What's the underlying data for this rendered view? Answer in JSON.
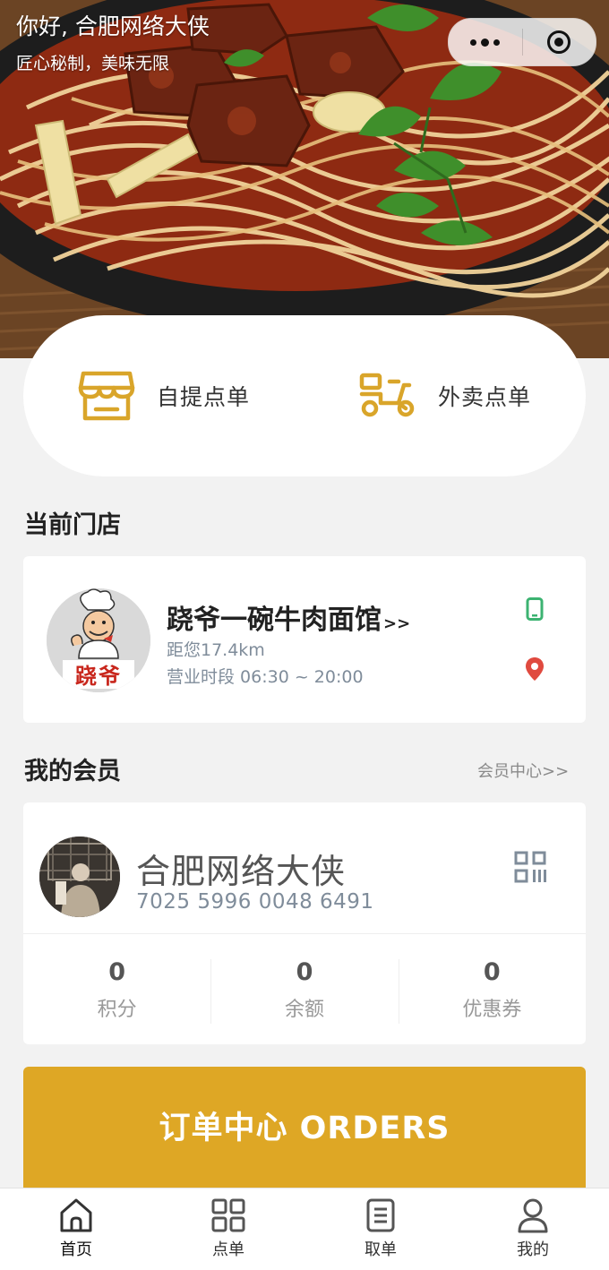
{
  "header": {
    "greeting": "你好, 合肥网络大侠",
    "slogan": "匠心秘制，美味无限"
  },
  "capsule": {
    "more_icon": "more-dots-icon",
    "close_icon": "target-icon"
  },
  "order_modes": [
    {
      "label": "自提点单",
      "icon": "storefront-icon"
    },
    {
      "label": "外卖点单",
      "icon": "scooter-icon"
    }
  ],
  "store_section": {
    "title": "当前门店",
    "store": {
      "name": "跷爷一碗牛肉面馆",
      "arrow": ">>",
      "distance": "距您17.4km",
      "hours": "营业时段 06:30 ~ 20:00",
      "logo_text": "跷爷"
    }
  },
  "member_section": {
    "title": "我的会员",
    "link": "会员中心>>",
    "member": {
      "name": "合肥网络大侠",
      "number": "7025 5996 0048 6491"
    },
    "stats": [
      {
        "value": "0",
        "label": "积分"
      },
      {
        "value": "0",
        "label": "余额"
      },
      {
        "value": "0",
        "label": "优惠券"
      }
    ]
  },
  "orders_button": {
    "label": "订单中心 ORDERS"
  },
  "tabbar": [
    {
      "label": "首页",
      "icon": "home-icon",
      "active": true
    },
    {
      "label": "点单",
      "icon": "grid-icon",
      "active": false
    },
    {
      "label": "取单",
      "icon": "receipt-icon",
      "active": false
    },
    {
      "label": "我的",
      "icon": "user-icon",
      "active": false
    }
  ],
  "colors": {
    "accent": "#dea725",
    "icon_gold": "#d9a52a",
    "phone_green": "#3cb371",
    "location_red": "#e04a3f",
    "background": "#f2f2f2"
  }
}
